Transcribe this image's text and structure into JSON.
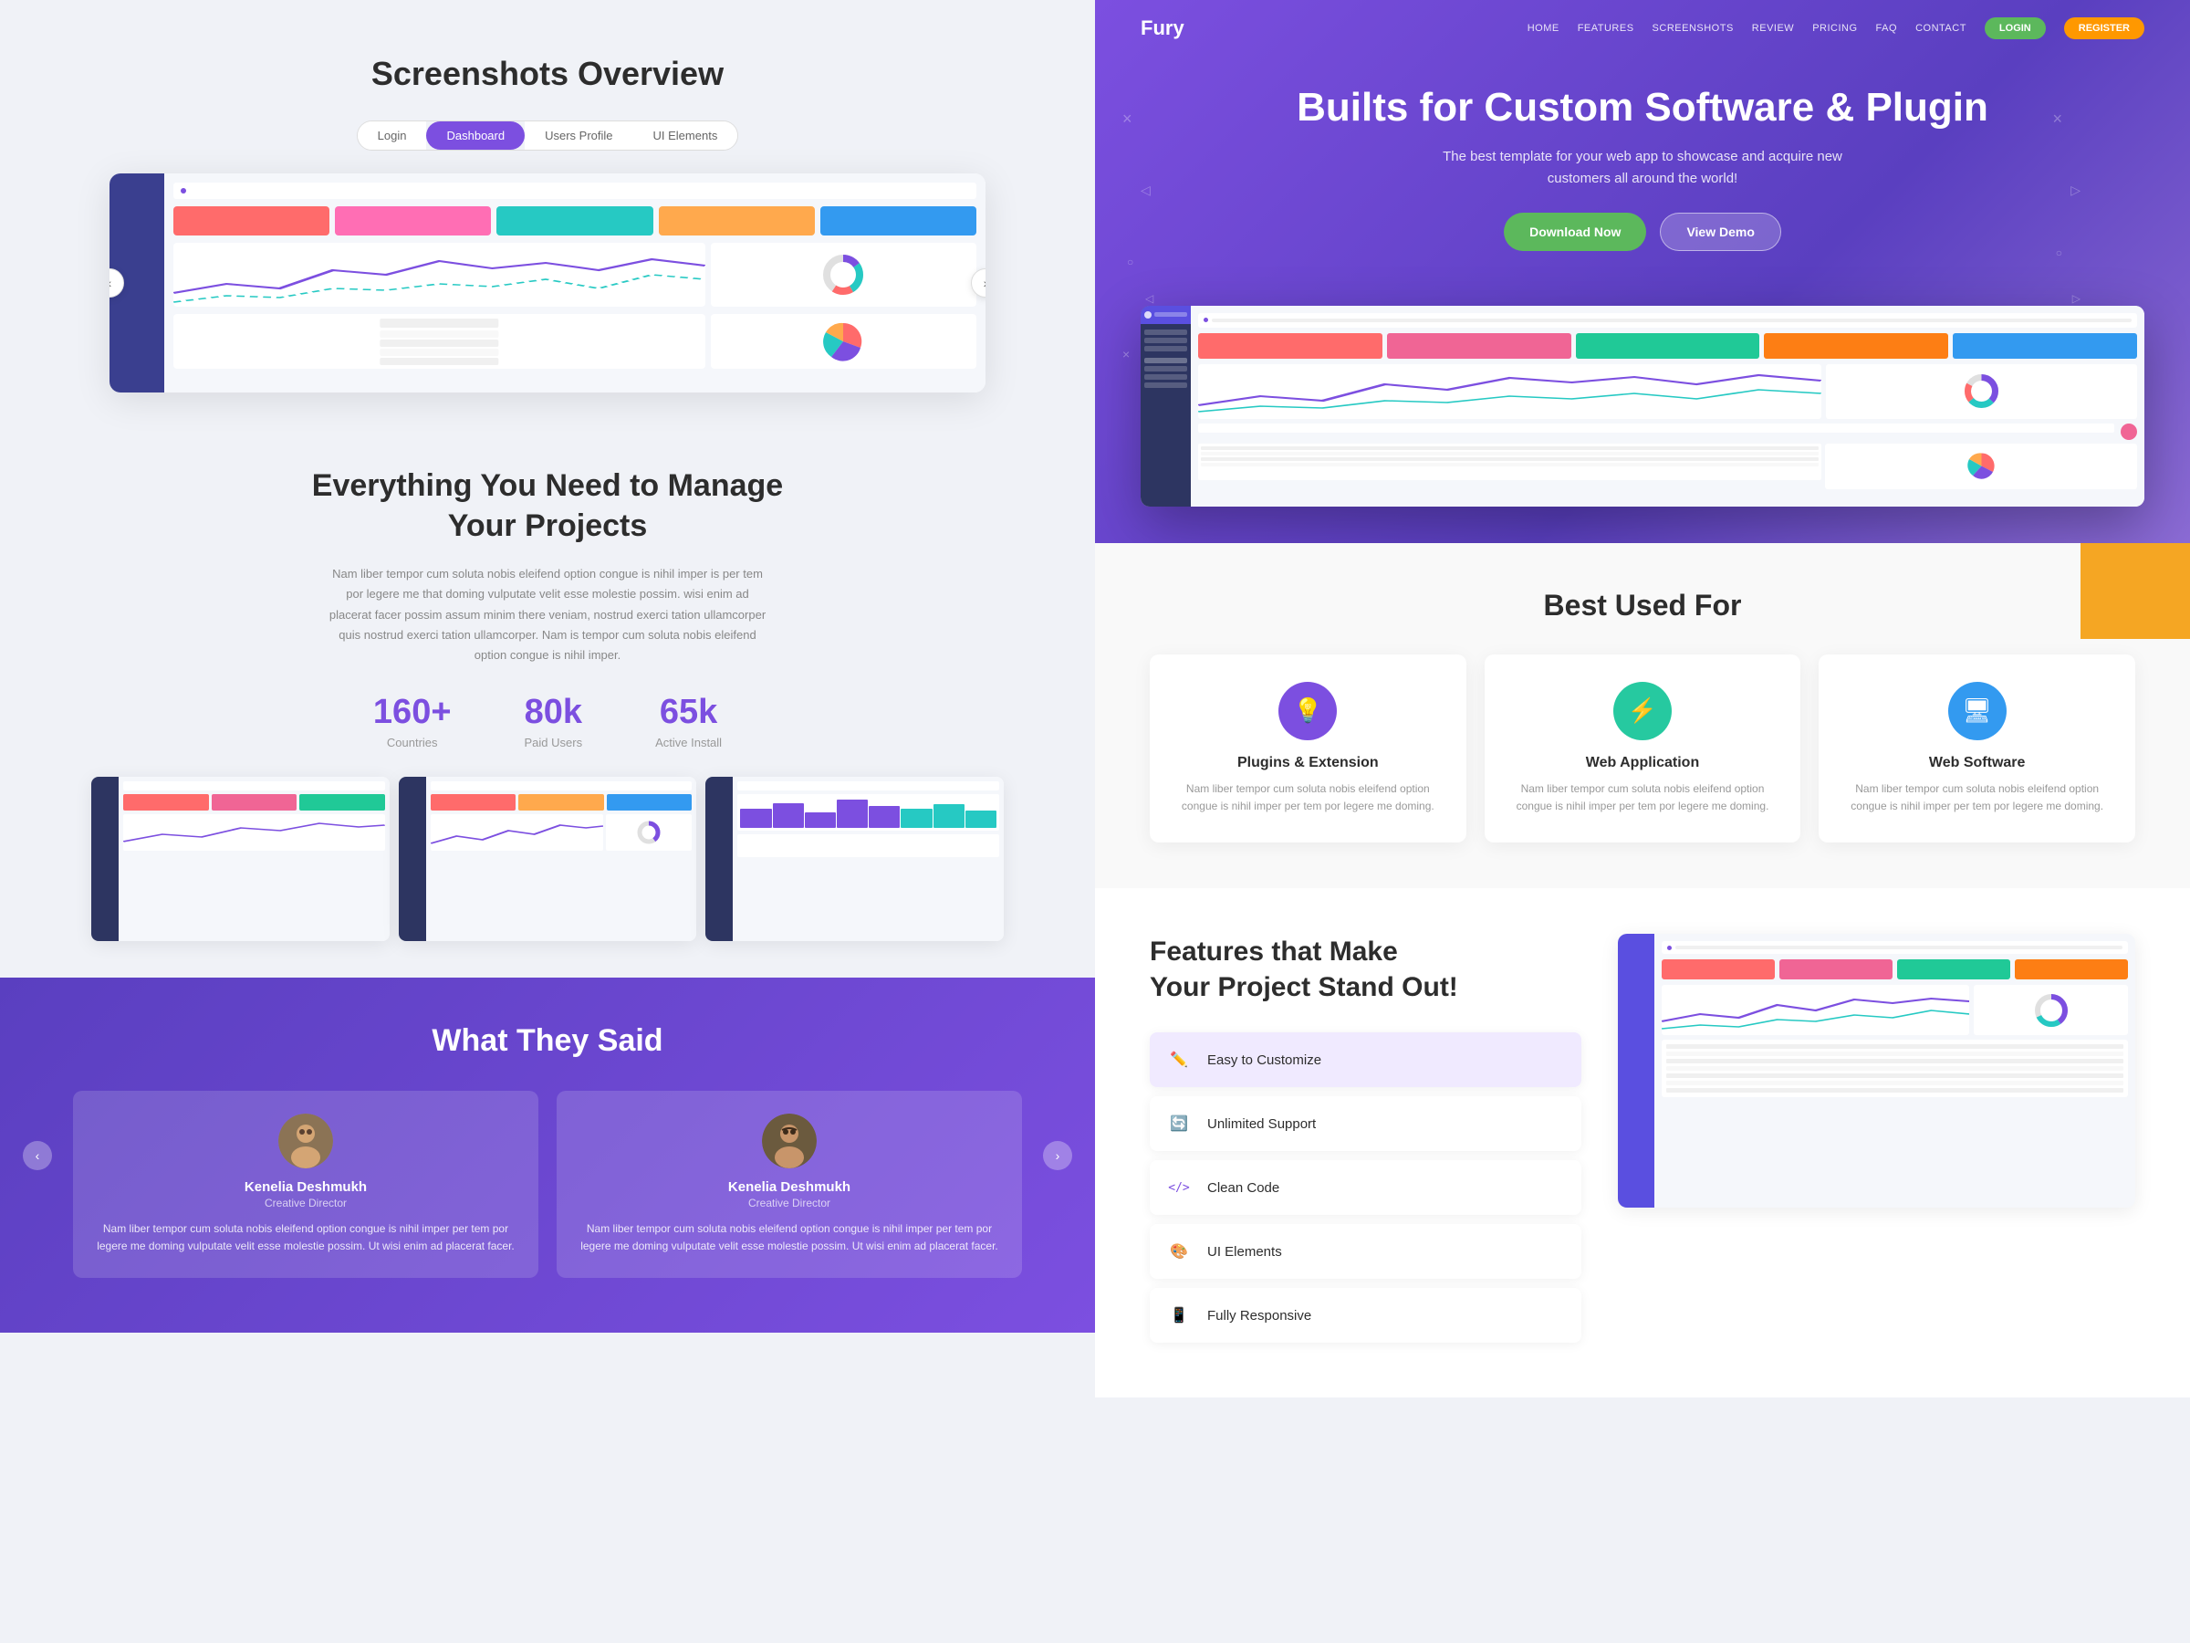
{
  "left": {
    "screenshots": {
      "title": "Screenshots Overview",
      "tabs": [
        "Login",
        "Dashboard",
        "Users Profile",
        "UI Elements"
      ]
    },
    "stats": {
      "title": "Everything You Need to Manage\nYour Projects",
      "description": "Nam liber tempor cum soluta nobis eleifend option congue is nihil imper is per tem por legere me that doming vulputate velit esse molestie possim. wisi enim ad placerat facer possim assum minim there veniam, nostrud exerci tation ullamcorper quis nostrud exerci tation ullamcorper. Nam is tempor cum soluta nobis eleifend option congue is nihil imper.",
      "numbers": [
        {
          "value": "160+",
          "label": "Countries"
        },
        {
          "value": "80k",
          "label": "Paid Users"
        },
        {
          "value": "65k",
          "label": "Active Install"
        }
      ]
    },
    "testimonials": {
      "title": "What They Said",
      "cards": [
        {
          "name": "Kenelia Deshmukh",
          "role": "Creative Director",
          "text": "Nam liber tempor cum soluta nobis eleifend option congue is nihil imper per tem por legere me doming vulputate velit esse molestie possim. Ut wisi enim ad placerat facer."
        },
        {
          "name": "Kenelia Deshmukh",
          "role": "Creative Director",
          "text": "Nam liber tempor cum soluta nobis eleifend option congue is nihil imper per tem por legere me doming vulputate velit esse molestie possim. Ut wisi enim ad placerat facer."
        }
      ]
    }
  },
  "right": {
    "nav": {
      "logo": "Fury",
      "links": [
        "HOME",
        "FEATURES",
        "SCREENSHOTS",
        "REVIEW",
        "PRICING",
        "FAQ",
        "CONTACT"
      ],
      "buttons": {
        "login": "LOGIN",
        "register": "REGISTER"
      }
    },
    "hero": {
      "title": "Builts for Custom Software & Plugin",
      "subtitle": "The best template for your web app to showcase and acquire new\ncustomers all around the world!",
      "download_btn": "Download Now",
      "demo_btn": "View Demo"
    },
    "best_used": {
      "title": "Best Used For",
      "cards": [
        {
          "icon": "💡",
          "title": "Plugins & Extension",
          "desc": "Nam liber tempor cum soluta nobis eleifend option congue is nihil imper per tem por legere me doming."
        },
        {
          "icon": "⚡",
          "title": "Web Application",
          "desc": "Nam liber tempor cum soluta nobis eleifend option congue is nihil imper per tem por legere me doming."
        },
        {
          "icon": "🖥",
          "title": "Web Software",
          "desc": "Nam liber tempor cum soluta nobis eleifend option congue is nihil imper per tem por legere me doming."
        }
      ]
    },
    "features": {
      "title": "Features that Make\nYour Project Stand Out!",
      "items": [
        {
          "label": "Easy to Customize",
          "icon": "✏️",
          "active": true
        },
        {
          "label": "Unlimited Support",
          "icon": "🔄",
          "active": false
        },
        {
          "label": "Clean Code",
          "icon": "</>",
          "active": false
        },
        {
          "label": "UI Elements",
          "icon": "🎨",
          "active": false
        },
        {
          "label": "Fully Responsive",
          "icon": "📱",
          "active": false
        }
      ]
    }
  }
}
